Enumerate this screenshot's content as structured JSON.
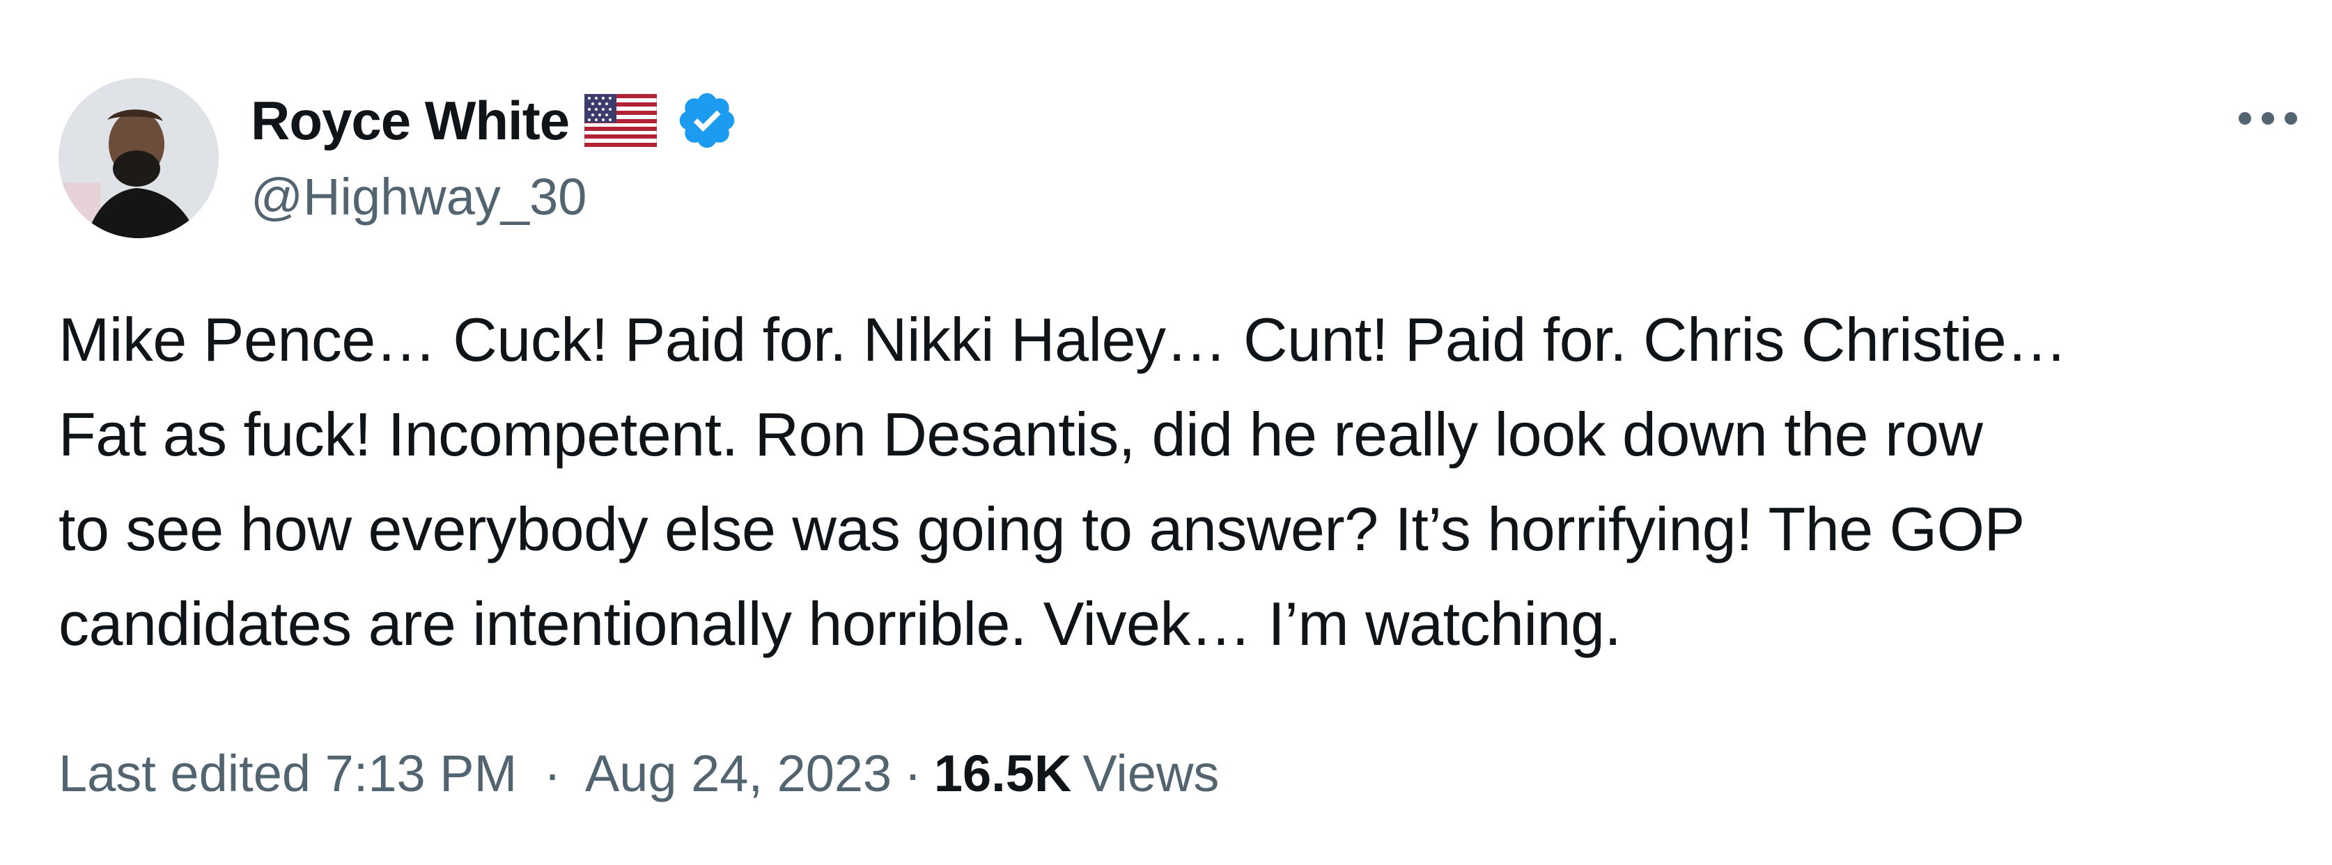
{
  "author": {
    "display_name": "Royce White",
    "handle": "@Highway_30",
    "flag_icon": "us-flag-icon",
    "verified_icon": "verified-badge-icon",
    "verified_color": "#1d9bf0"
  },
  "menu": {
    "more_icon": "more-options-icon"
  },
  "tweet": {
    "lines": [
      "Mike Pence… Cuck! Paid for. Nikki Haley… Cunt! Paid for. Chris Christie…",
      "Fat as fuck! Incompetent. Ron Desantis, did he really look down the row",
      "to see how everybody else was going to answer? It’s horrifying! The GOP",
      "candidates are intentionally horrible. Vivek… I’m watching."
    ]
  },
  "meta": {
    "edited_label": "Last edited",
    "time": "7:13 PM",
    "separator": "·",
    "date": "Aug 24, 2023",
    "views_count": "16.5K",
    "views_label": "Views"
  },
  "colors": {
    "text_primary": "#0f1419",
    "text_secondary": "#536471",
    "accent": "#1d9bf0"
  }
}
